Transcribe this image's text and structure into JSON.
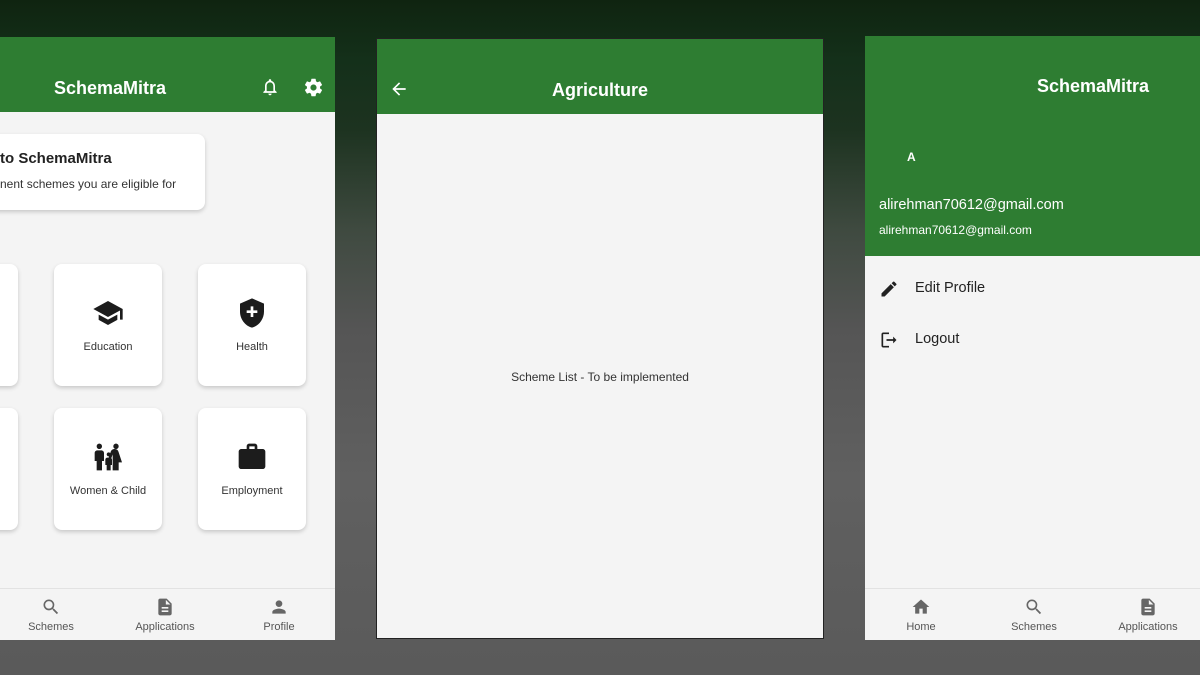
{
  "screen1": {
    "title": "SchemaMitra",
    "welcome_title": "to SchemaMitra",
    "welcome_subtitle": "nent schemes you are eligible for",
    "categories": [
      {
        "label": "Education",
        "icon": "graduation-cap-icon"
      },
      {
        "label": "Health",
        "icon": "health-shield-icon"
      },
      {
        "label": "Women & Child",
        "icon": "family-icon"
      },
      {
        "label": "Employment",
        "icon": "briefcase-icon"
      }
    ],
    "nav": [
      "Schemes",
      "Applications",
      "Profile"
    ]
  },
  "screen2": {
    "title": "Agriculture",
    "placeholder": "Scheme List - To be implemented"
  },
  "screen3": {
    "title": "SchemaMitra",
    "avatar_letter": "A",
    "email_primary": "alirehman70612@gmail.com",
    "email_secondary": "alirehman70612@gmail.com",
    "menu": [
      "Edit Profile",
      "Logout"
    ],
    "nav": [
      "Home",
      "Schemes",
      "Applications"
    ]
  },
  "colors": {
    "primary": "#2e7d32",
    "surface": "#f4f4f4",
    "card": "#ffffff"
  }
}
